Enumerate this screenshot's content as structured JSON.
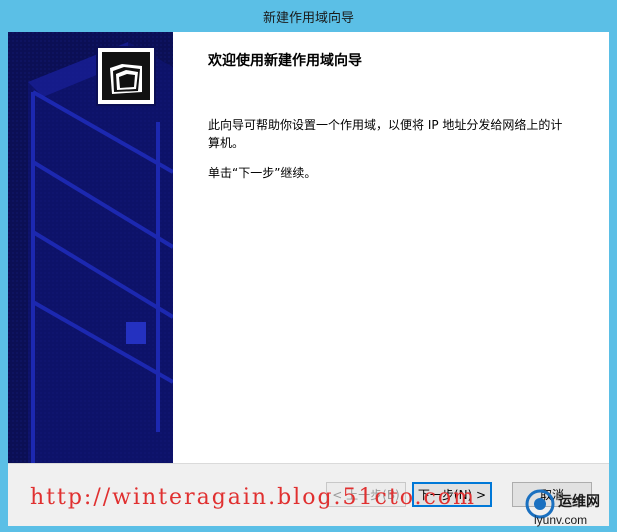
{
  "window": {
    "title": "新建作用域向导"
  },
  "content": {
    "heading": "欢迎使用新建作用域向导",
    "description": "此向导可帮助你设置一个作用域，以便将 IP 地址分发给网络上的计算机。",
    "hint": "单击“下一步”继续。"
  },
  "buttons": {
    "back": "< 上一步(B)",
    "next": "下一步(N) >",
    "cancel": "取消"
  },
  "overlay": {
    "watermark_url": "http://winteragain.blog.51cto.com",
    "logo_text": "运维网",
    "logo_sub": "iyunv.com"
  }
}
